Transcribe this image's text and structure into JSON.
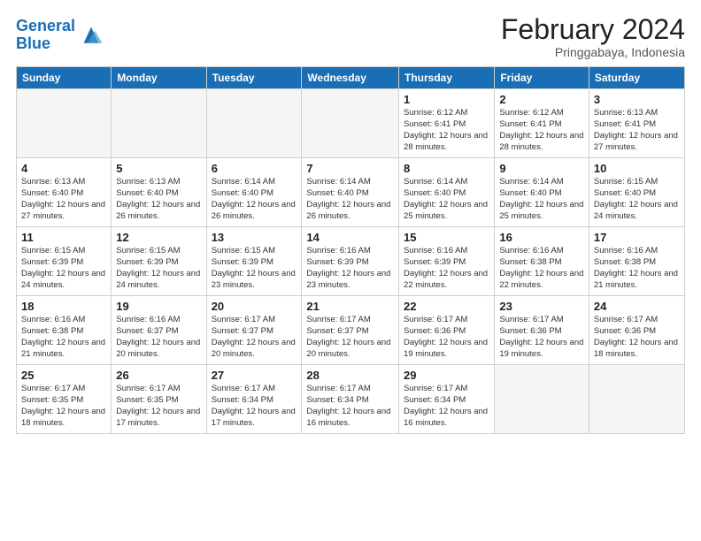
{
  "logo": {
    "line1": "General",
    "line2": "Blue"
  },
  "title": "February 2024",
  "subtitle": "Pringgabaya, Indonesia",
  "weekdays": [
    "Sunday",
    "Monday",
    "Tuesday",
    "Wednesday",
    "Thursday",
    "Friday",
    "Saturday"
  ],
  "weeks": [
    [
      {
        "day": "",
        "info": ""
      },
      {
        "day": "",
        "info": ""
      },
      {
        "day": "",
        "info": ""
      },
      {
        "day": "",
        "info": ""
      },
      {
        "day": "1",
        "info": "Sunrise: 6:12 AM\nSunset: 6:41 PM\nDaylight: 12 hours and 28 minutes."
      },
      {
        "day": "2",
        "info": "Sunrise: 6:12 AM\nSunset: 6:41 PM\nDaylight: 12 hours and 28 minutes."
      },
      {
        "day": "3",
        "info": "Sunrise: 6:13 AM\nSunset: 6:41 PM\nDaylight: 12 hours and 27 minutes."
      }
    ],
    [
      {
        "day": "4",
        "info": "Sunrise: 6:13 AM\nSunset: 6:40 PM\nDaylight: 12 hours and 27 minutes."
      },
      {
        "day": "5",
        "info": "Sunrise: 6:13 AM\nSunset: 6:40 PM\nDaylight: 12 hours and 26 minutes."
      },
      {
        "day": "6",
        "info": "Sunrise: 6:14 AM\nSunset: 6:40 PM\nDaylight: 12 hours and 26 minutes."
      },
      {
        "day": "7",
        "info": "Sunrise: 6:14 AM\nSunset: 6:40 PM\nDaylight: 12 hours and 26 minutes."
      },
      {
        "day": "8",
        "info": "Sunrise: 6:14 AM\nSunset: 6:40 PM\nDaylight: 12 hours and 25 minutes."
      },
      {
        "day": "9",
        "info": "Sunrise: 6:14 AM\nSunset: 6:40 PM\nDaylight: 12 hours and 25 minutes."
      },
      {
        "day": "10",
        "info": "Sunrise: 6:15 AM\nSunset: 6:40 PM\nDaylight: 12 hours and 24 minutes."
      }
    ],
    [
      {
        "day": "11",
        "info": "Sunrise: 6:15 AM\nSunset: 6:39 PM\nDaylight: 12 hours and 24 minutes."
      },
      {
        "day": "12",
        "info": "Sunrise: 6:15 AM\nSunset: 6:39 PM\nDaylight: 12 hours and 24 minutes."
      },
      {
        "day": "13",
        "info": "Sunrise: 6:15 AM\nSunset: 6:39 PM\nDaylight: 12 hours and 23 minutes."
      },
      {
        "day": "14",
        "info": "Sunrise: 6:16 AM\nSunset: 6:39 PM\nDaylight: 12 hours and 23 minutes."
      },
      {
        "day": "15",
        "info": "Sunrise: 6:16 AM\nSunset: 6:39 PM\nDaylight: 12 hours and 22 minutes."
      },
      {
        "day": "16",
        "info": "Sunrise: 6:16 AM\nSunset: 6:38 PM\nDaylight: 12 hours and 22 minutes."
      },
      {
        "day": "17",
        "info": "Sunrise: 6:16 AM\nSunset: 6:38 PM\nDaylight: 12 hours and 21 minutes."
      }
    ],
    [
      {
        "day": "18",
        "info": "Sunrise: 6:16 AM\nSunset: 6:38 PM\nDaylight: 12 hours and 21 minutes."
      },
      {
        "day": "19",
        "info": "Sunrise: 6:16 AM\nSunset: 6:37 PM\nDaylight: 12 hours and 20 minutes."
      },
      {
        "day": "20",
        "info": "Sunrise: 6:17 AM\nSunset: 6:37 PM\nDaylight: 12 hours and 20 minutes."
      },
      {
        "day": "21",
        "info": "Sunrise: 6:17 AM\nSunset: 6:37 PM\nDaylight: 12 hours and 20 minutes."
      },
      {
        "day": "22",
        "info": "Sunrise: 6:17 AM\nSunset: 6:36 PM\nDaylight: 12 hours and 19 minutes."
      },
      {
        "day": "23",
        "info": "Sunrise: 6:17 AM\nSunset: 6:36 PM\nDaylight: 12 hours and 19 minutes."
      },
      {
        "day": "24",
        "info": "Sunrise: 6:17 AM\nSunset: 6:36 PM\nDaylight: 12 hours and 18 minutes."
      }
    ],
    [
      {
        "day": "25",
        "info": "Sunrise: 6:17 AM\nSunset: 6:35 PM\nDaylight: 12 hours and 18 minutes."
      },
      {
        "day": "26",
        "info": "Sunrise: 6:17 AM\nSunset: 6:35 PM\nDaylight: 12 hours and 17 minutes."
      },
      {
        "day": "27",
        "info": "Sunrise: 6:17 AM\nSunset: 6:34 PM\nDaylight: 12 hours and 17 minutes."
      },
      {
        "day": "28",
        "info": "Sunrise: 6:17 AM\nSunset: 6:34 PM\nDaylight: 12 hours and 16 minutes."
      },
      {
        "day": "29",
        "info": "Sunrise: 6:17 AM\nSunset: 6:34 PM\nDaylight: 12 hours and 16 minutes."
      },
      {
        "day": "",
        "info": ""
      },
      {
        "day": "",
        "info": ""
      }
    ]
  ]
}
